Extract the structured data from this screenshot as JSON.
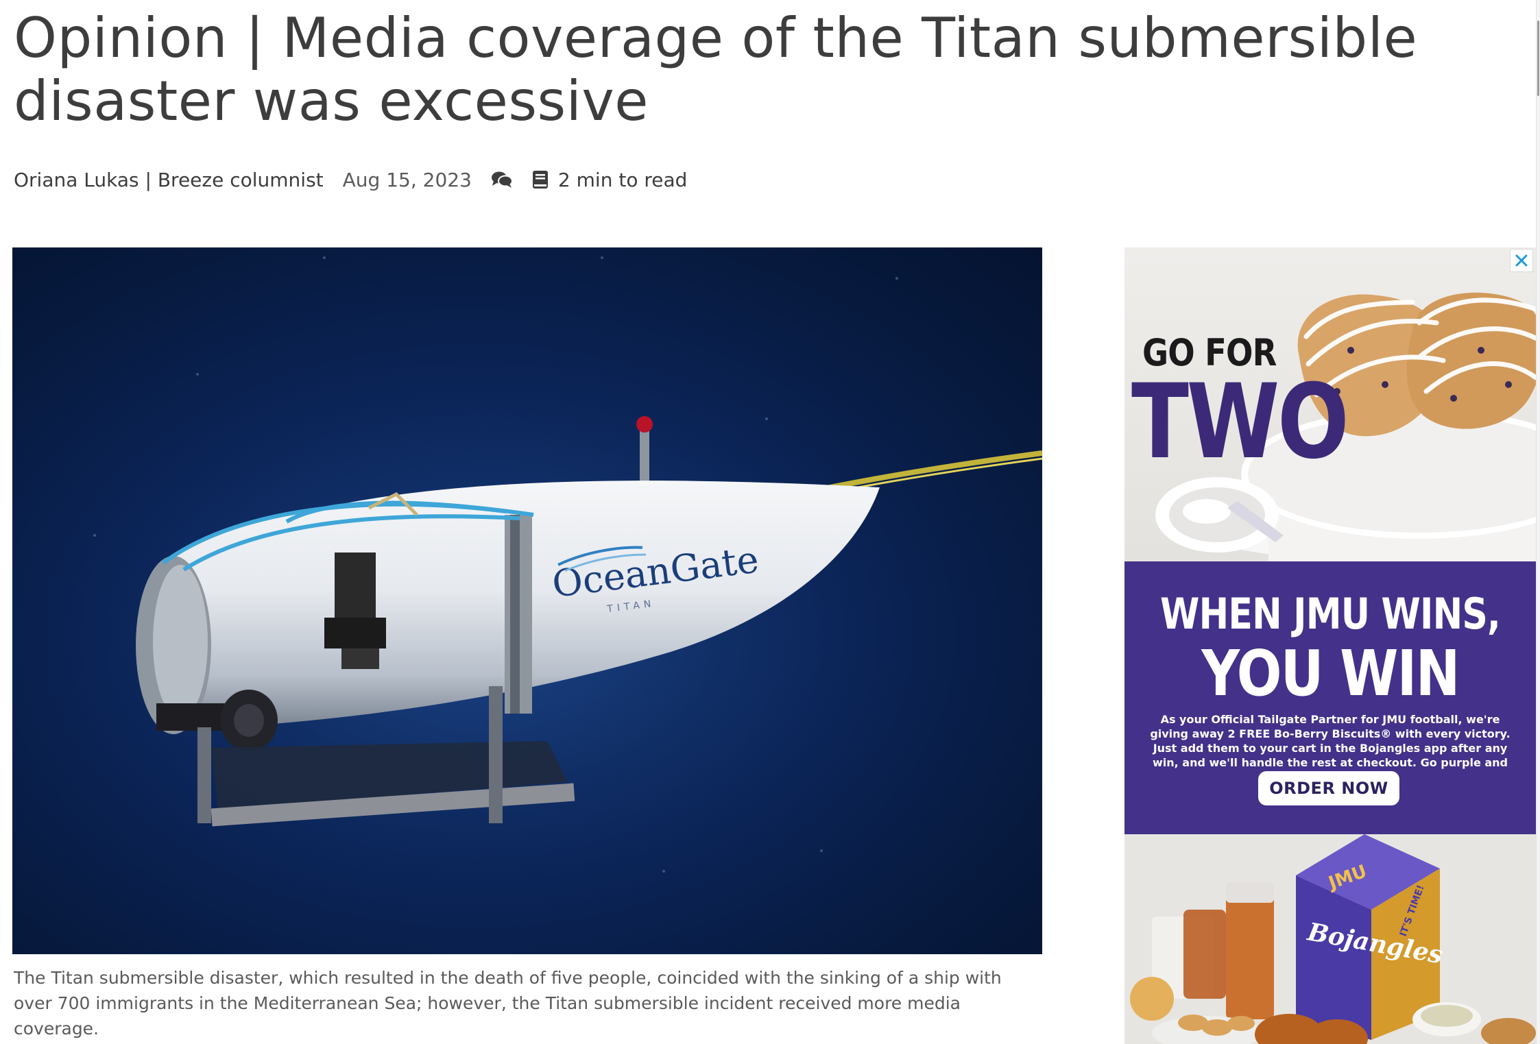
{
  "article": {
    "headline": "Opinion | Media coverage of the Titan submersible disaster was excessive",
    "author": "Oriana Lukas | Breeze columnist",
    "date": "Aug 15, 2023",
    "read_time": "2 min to read",
    "photo": {
      "brand_text": "OceanGate",
      "model_text": "TITAN"
    },
    "caption": "The Titan submersible disaster, which resulted in the death of five people, coincided with the sinking of a ship with over 700 immigrants in the Mediterranean Sea; however, the Titan submersible incident received more media coverage."
  },
  "ad": {
    "line1": "GO FOR",
    "line2": "TWO",
    "headline1": "WHEN JMU WINS,",
    "headline2": "YOU WIN",
    "body": "As your Official Tailgate Partner for JMU football, we're giving away 2 FREE Bo-Berry Biscuits® with every victory. Just add them to your cart in the Bojangles app after any win, and we'll handle the rest at checkout. Go purple and gold!",
    "button_label": "ORDER NOW",
    "box_brand": "Bojangles",
    "box_school": "JMU",
    "box_tag": "IT'S TIME!",
    "colors": {
      "purple": "#43318a",
      "deep_purple": "#3c2a78",
      "gold": "#e2a93a"
    }
  },
  "icons": {
    "comments": "comments-icon",
    "read_time": "book-icon",
    "close": "close-icon"
  }
}
